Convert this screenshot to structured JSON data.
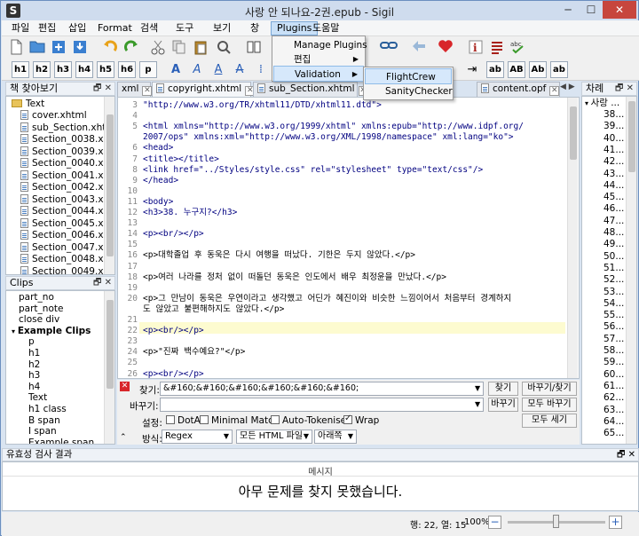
{
  "window": {
    "title": "사랑 안 되나요-2권.epub - Sigil",
    "app_icon": "S",
    "minimize": "─",
    "maximize": "☐",
    "close": "✕"
  },
  "menubar": [
    "파일",
    "편집",
    "삽입",
    "Format",
    "검색",
    "도구",
    "보기",
    "창",
    "Plugins",
    "도움말"
  ],
  "plugins_menu": {
    "items": [
      "Manage Plugins",
      "편집",
      "Validation"
    ]
  },
  "validation_submenu": {
    "items": [
      "FlightCrew",
      "SanityChecker"
    ]
  },
  "heading_buttons": [
    "h1",
    "h2",
    "h3",
    "h4",
    "h5",
    "h6",
    "p"
  ],
  "toolbar2_extra": [
    "ab",
    "AB",
    "Ab",
    "ab"
  ],
  "book_browser": {
    "title": "책 찾아보기",
    "folder": "Text",
    "files": [
      "cover.xhtml",
      "sub_Section.xht...",
      "Section_0038.x...",
      "Section_0039.x...",
      "Section_0040.x...",
      "Section_0041.x...",
      "Section_0042.x...",
      "Section_0043.x...",
      "Section_0044.x...",
      "Section_0045.x...",
      "Section_0046.x...",
      "Section_0047.x...",
      "Section_0048.x...",
      "Section_0049.x..."
    ]
  },
  "clips": {
    "title": "Clips",
    "items": [
      "part_no",
      "part_note",
      "close div",
      "Example Clips",
      "p",
      "h1",
      "h2",
      "h3",
      "h4",
      "Text",
      "h1 class",
      "B span",
      "I span",
      "Example span"
    ]
  },
  "tabs": [
    {
      "label": "xml"
    },
    {
      "label": "copyright.xhtml"
    },
    {
      "label": "sub_Section.xhtml"
    },
    {
      "label": "content.opf"
    }
  ],
  "editor": {
    "lines": [
      {
        "n": "3",
        "text": "  \"http://www.w3.org/TR/xhtml11/DTD/xhtml11.dtd\">",
        "kind": "tag"
      },
      {
        "n": "4",
        "text": "",
        "kind": "tag"
      },
      {
        "n": "5",
        "text": "<html xmlns=\"http://www.w3.org/1999/xhtml\" xmlns:epub=\"http://www.idpf.org/",
        "kind": "tag"
      },
      {
        "n": "",
        "text": "2007/ops\" xmlns:xml=\"http://www.w3.org/XML/1998/namespace\" xml:lang=\"ko\">",
        "kind": "tag"
      },
      {
        "n": "6",
        "text": "<head>",
        "kind": "tag"
      },
      {
        "n": "7",
        "text": "  <title></title>",
        "kind": "tag"
      },
      {
        "n": "8",
        "text": "  <link href=\"../Styles/style.css\" rel=\"stylesheet\" type=\"text/css\"/>",
        "kind": "tag"
      },
      {
        "n": "9",
        "text": "</head>",
        "kind": "tag"
      },
      {
        "n": "10",
        "text": "",
        "kind": "tag"
      },
      {
        "n": "11",
        "text": "<body>",
        "kind": "tag"
      },
      {
        "n": "12",
        "text": "  <h3>38. 누구지?</h3>",
        "kind": "tag"
      },
      {
        "n": "13",
        "text": "",
        "kind": "tag"
      },
      {
        "n": "14",
        "text": "  <p><br/></p>",
        "kind": "tag"
      },
      {
        "n": "15",
        "text": "",
        "kind": "tag"
      },
      {
        "n": "16",
        "text": "  <p>대학졸업 후 동욱은 다시 여행을 떠났다. 기한은 두지 않았다.</p>",
        "kind": "text"
      },
      {
        "n": "17",
        "text": "",
        "kind": "tag"
      },
      {
        "n": "18",
        "text": "  <p>여러 나라를 정처 없이 떠돌던 동욱은 인도에서 배우 최정윤을 만났다.</p>",
        "kind": "text"
      },
      {
        "n": "19",
        "text": "",
        "kind": "tag"
      },
      {
        "n": "20",
        "text": "  <p>그 만남이 동욱은 우연이라고 생각했고 어딘가 혜진이와 비슷한 느낌이어서 처음부터 경계하지",
        "kind": "text"
      },
      {
        "n": "",
        "text": "도 않았고 불편해하지도 않았다.</p>",
        "kind": "text"
      },
      {
        "n": "21",
        "text": "",
        "kind": "tag"
      },
      {
        "n": "22",
        "text": "  <p><br/></p>",
        "kind": "tag"
      },
      {
        "n": "23",
        "text": "",
        "kind": "tag"
      },
      {
        "n": "24",
        "text": "  <p>\"진짜 백수예요?\"</p>",
        "kind": "text"
      },
      {
        "n": "25",
        "text": "",
        "kind": "tag"
      },
      {
        "n": "26",
        "text": "  <p><br/></p>",
        "kind": "tag"
      }
    ]
  },
  "findbar": {
    "find_label": "찾기:",
    "find_value": "&#160;&#160;&#160;&#160;&#160;&#160;",
    "replace_label": "바꾸기:",
    "replace_value": "",
    "find_btn": "찾기",
    "replace_find_btn": "바꾸기/찾기",
    "replace_btn": "바꾸기",
    "replace_all_btn": "모두 바꾸기",
    "count_all_btn": "모두 세기",
    "settings_label": "설정:",
    "opt_dotall": "DotAll",
    "opt_minimal": "Minimal Match",
    "opt_autotok": "Auto-Tokenise",
    "opt_wrap": "Wrap",
    "mode_label": "방식:",
    "mode_value": "Regex",
    "scope_value": "모든 HTML 파일",
    "direction_value": "아래쪽"
  },
  "toc": {
    "title": "차례",
    "root": "사랑 ...",
    "items": [
      "38...",
      "39...",
      "40...",
      "41...",
      "42...",
      "43...",
      "44...",
      "45...",
      "46...",
      "47...",
      "48...",
      "49...",
      "50...",
      "51...",
      "52...",
      "53...",
      "54...",
      "55...",
      "56...",
      "57...",
      "58...",
      "59...",
      "60...",
      "61...",
      "62...",
      "63...",
      "64...",
      "65..."
    ]
  },
  "validation": {
    "title": "유효성 검사 결과",
    "column": "메시지",
    "message": "아무 문제를 찾지 못했습니다."
  },
  "status": {
    "position": "행: 22, 열: 15",
    "zoom": "100%",
    "zoom_level": 0.5
  }
}
